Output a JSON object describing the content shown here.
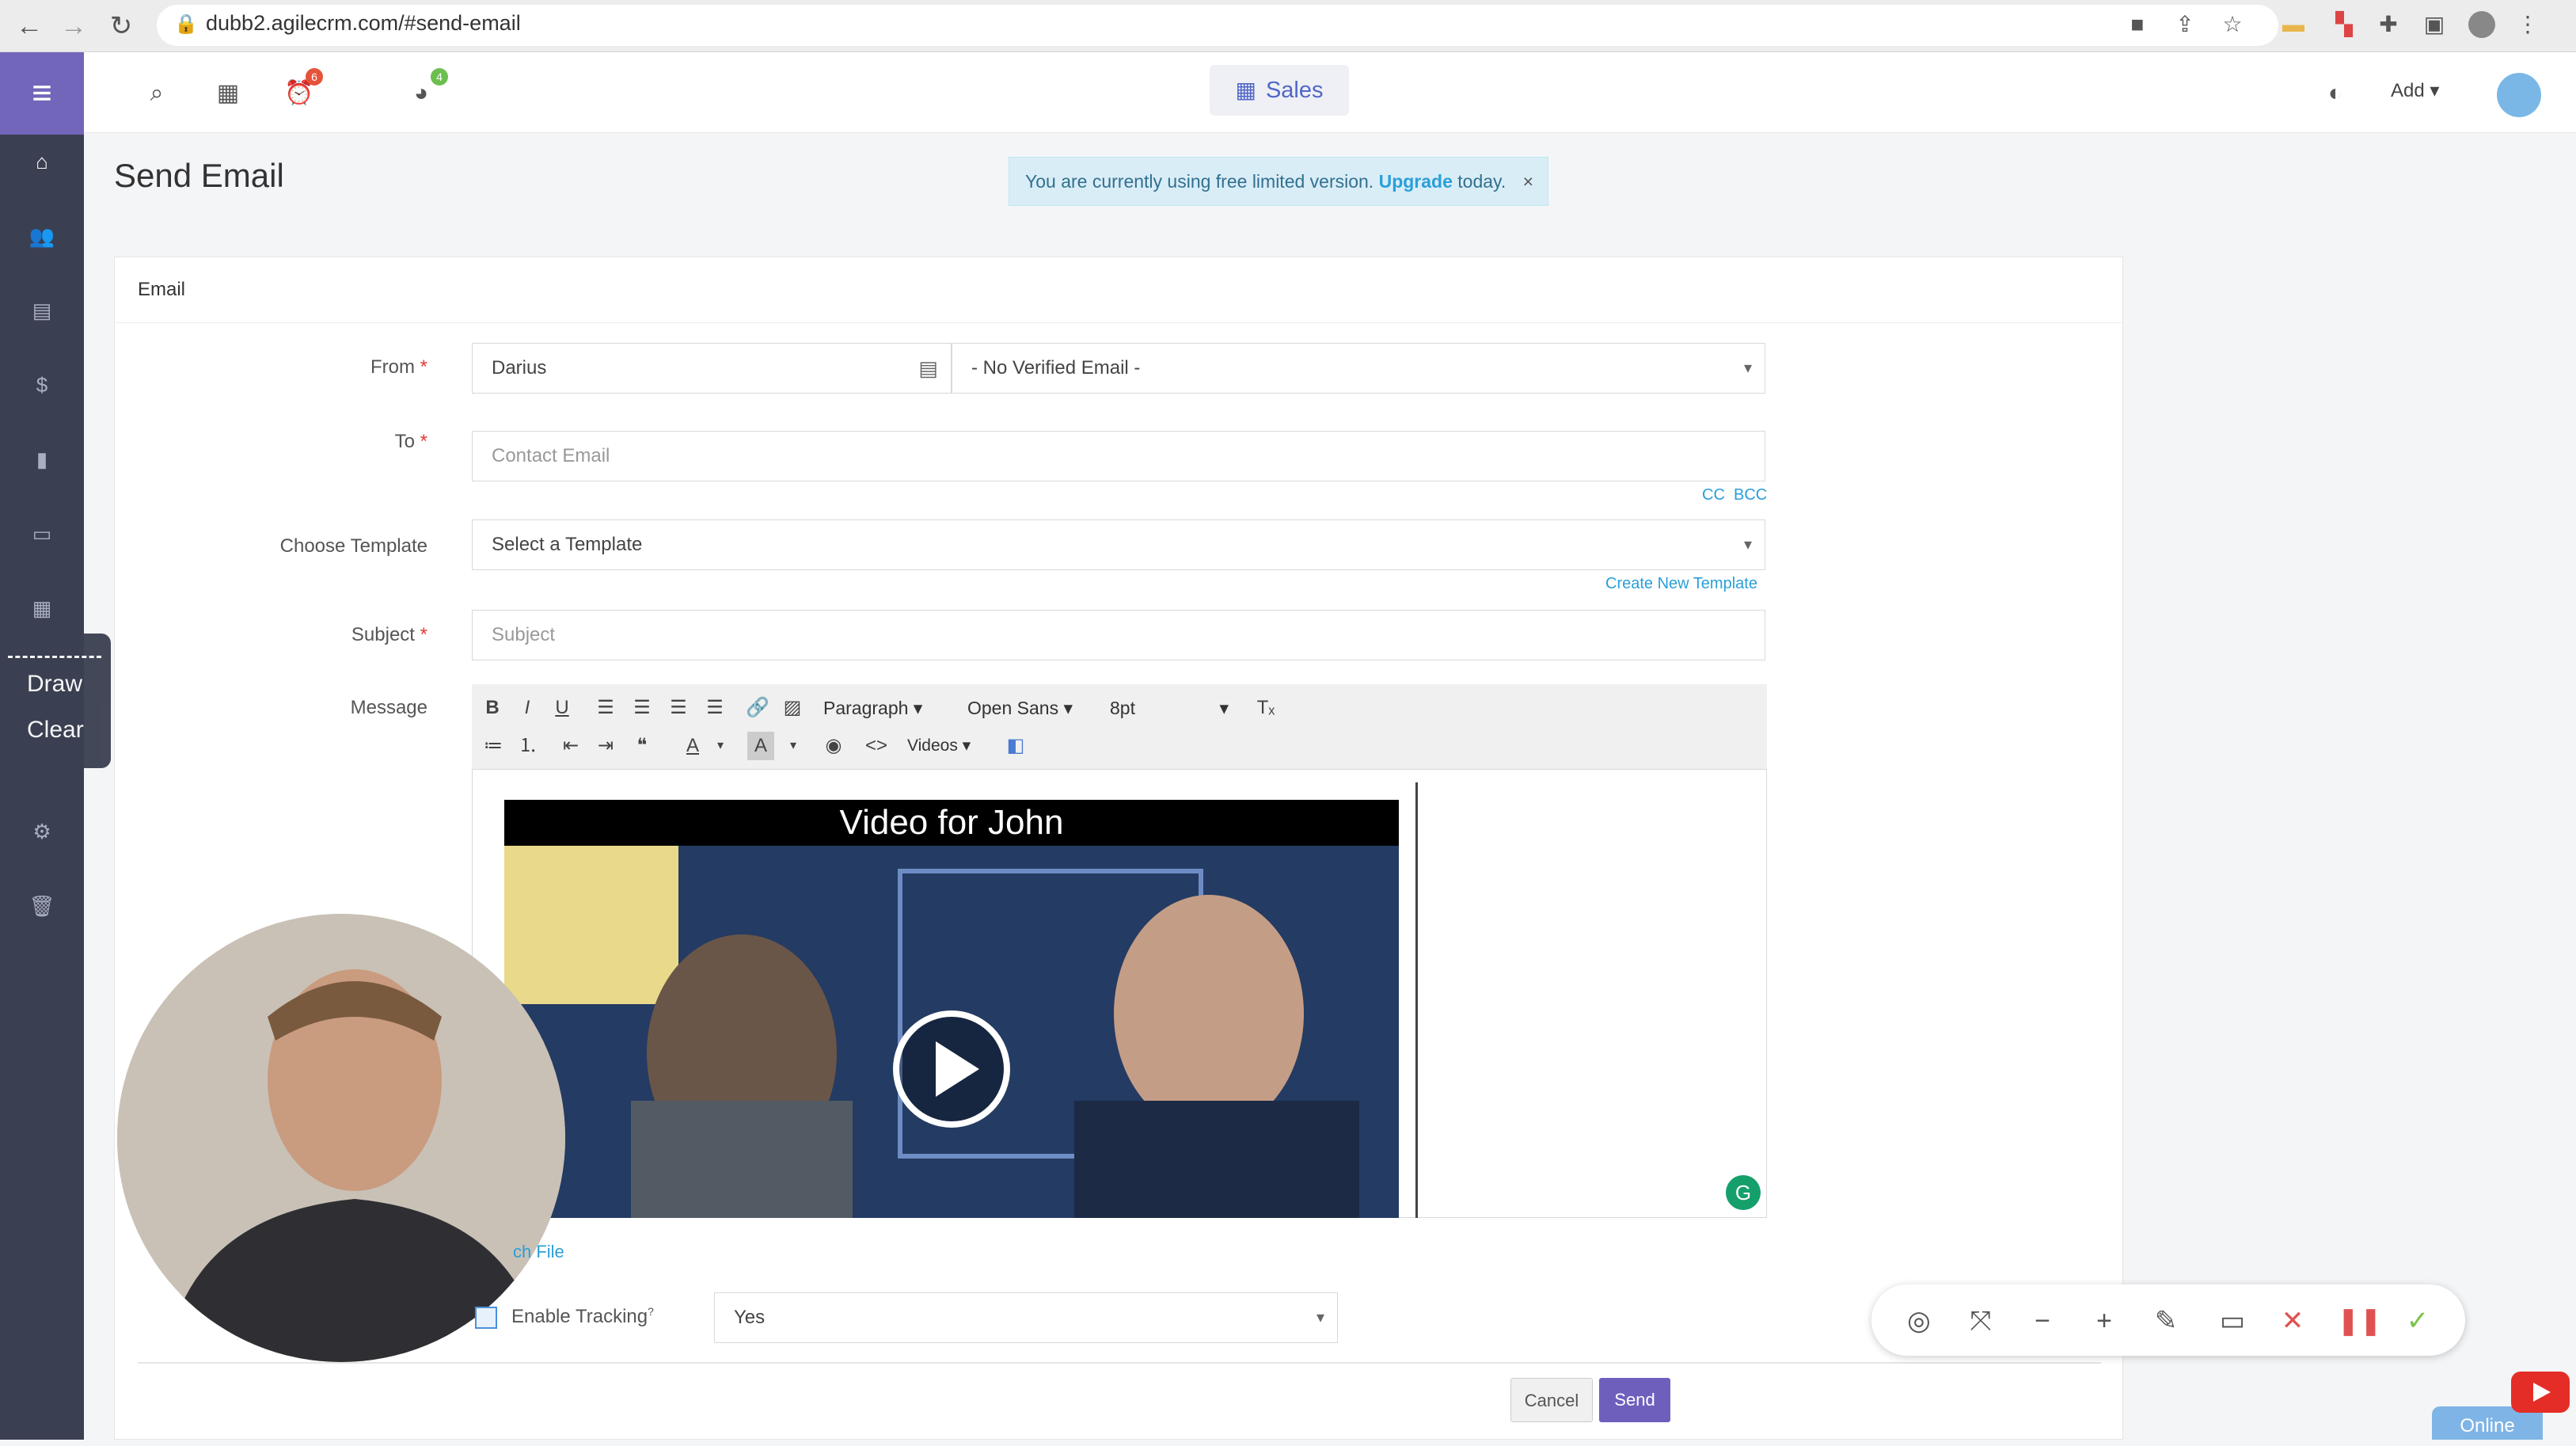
{
  "browser": {
    "url": "dubb2.agilecrm.com/#send-email",
    "back_icon": "arrow-left-icon",
    "forward_icon": "arrow-right-icon",
    "reload_icon": "reload-icon"
  },
  "topbar": {
    "sales_label": "Sales",
    "add_label": "Add",
    "reminder_badge": "6",
    "activity_badge": "4"
  },
  "page": {
    "title": "Send Email",
    "notice_text": "You are currently using free limited version.",
    "notice_link": "Upgrade",
    "notice_suffix": "today.",
    "notice_close": "×"
  },
  "panel": {
    "heading": "Email"
  },
  "form": {
    "from_label": "From",
    "from_name": "Darius",
    "from_email": "- No Verified Email -",
    "to_label": "To",
    "to_placeholder": "Contact Email",
    "cc": "CC",
    "bcc": "BCC",
    "template_label": "Choose Template",
    "template_value": "Select a Template",
    "create_template": "Create New Template",
    "subject_label": "Subject",
    "subject_placeholder": "Subject",
    "message_label": "Message",
    "required_mark": "*"
  },
  "editor": {
    "format_select": "Paragraph",
    "font_select": "Open Sans",
    "size_select": "8pt",
    "videos_select": "Videos",
    "video_title": "Video for John"
  },
  "bottom": {
    "attach_text": "ch File",
    "tracking_label": "Enable Tracking",
    "tracking_help": "?",
    "tracking_value": "Yes",
    "cancel_label": "Cancel",
    "send_label": "Send",
    "online_label": "Online"
  },
  "draw_menu": {
    "draw": "Draw",
    "clear": "Clear"
  },
  "colors": {
    "sidebar": "#3a3f51",
    "accent": "#7266ba",
    "link": "#2a9fd8",
    "send_button": "#6f5fbd"
  }
}
